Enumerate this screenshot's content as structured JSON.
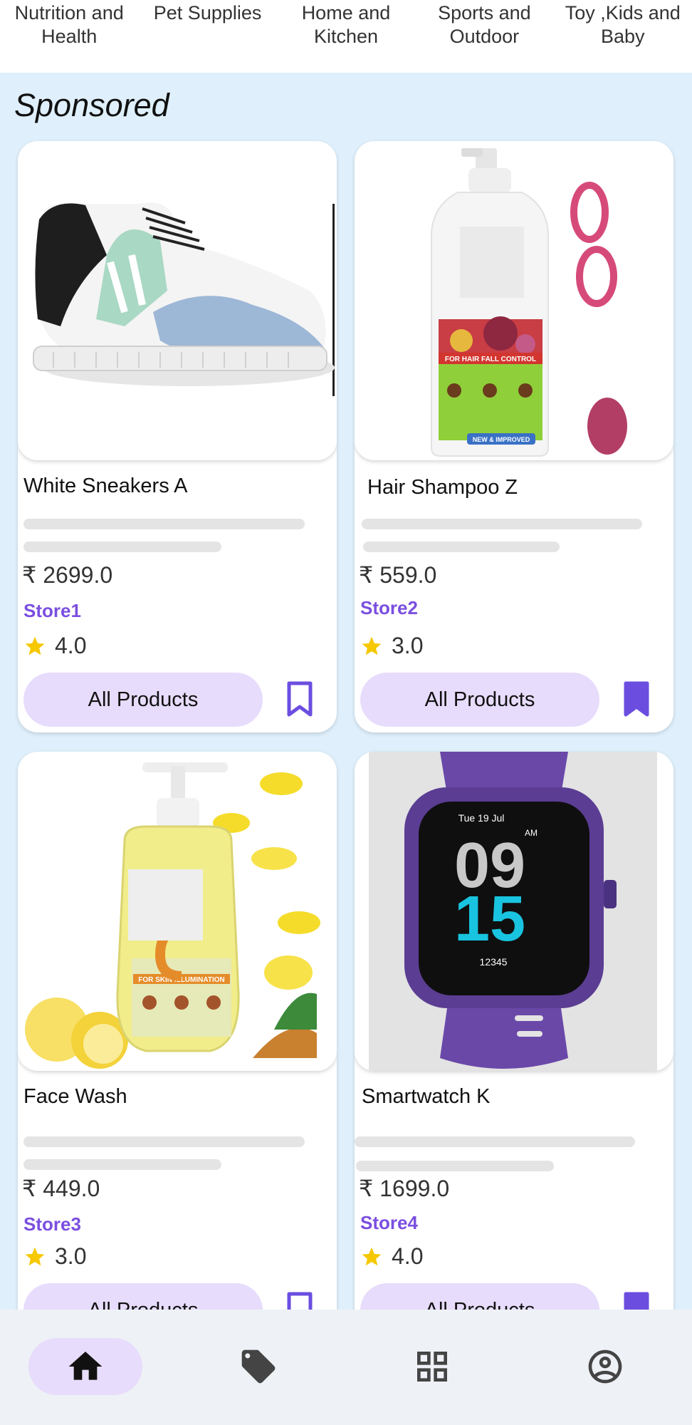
{
  "categories": [
    "Nutrition and Health",
    "Pet Supplies",
    "Home and Kitchen",
    "Sports and Outdoor",
    "Toy ,Kids and Baby"
  ],
  "section_title": "Sponsored",
  "products": [
    {
      "name": "White Sneakers A",
      "price": "₹ 2699.0",
      "store": "Store1",
      "rating": "4.0",
      "button": "All Products",
      "bookmarked": false
    },
    {
      "name": "Hair Shampoo Z",
      "price": "₹ 559.0",
      "store": "Store2",
      "rating": "3.0",
      "button": "All Products",
      "bookmarked": true
    },
    {
      "name": "Face Wash",
      "price": "₹ 449.0",
      "store": "Store3",
      "rating": "3.0",
      "button": "All Products",
      "bookmarked": false
    },
    {
      "name": "Smartwatch K",
      "price": "₹ 1699.0",
      "store": "Store4",
      "rating": "4.0",
      "button": "All Products",
      "bookmarked": true
    }
  ],
  "product_images": {
    "shampoo_label": "FOR HAIR FALL CONTROL",
    "shampoo_badge": "NEW & IMPROVED",
    "facewash_label": "FOR SKIN ILLUMINATION",
    "watch_date": "Tue 19 Jul",
    "watch_ampm": "AM",
    "watch_hour": "09",
    "watch_minute": "15",
    "watch_steps": "12345"
  },
  "bottom_nav": [
    {
      "icon": "home-icon",
      "active": true
    },
    {
      "icon": "tag-icon",
      "active": false
    },
    {
      "icon": "grid-icon",
      "active": false
    },
    {
      "icon": "account-icon",
      "active": false
    }
  ],
  "colors": {
    "accent": "#7b4fe0",
    "button_bg": "#e7dcfc",
    "page_bg": "#dff0fc",
    "star": "#f6c800"
  }
}
